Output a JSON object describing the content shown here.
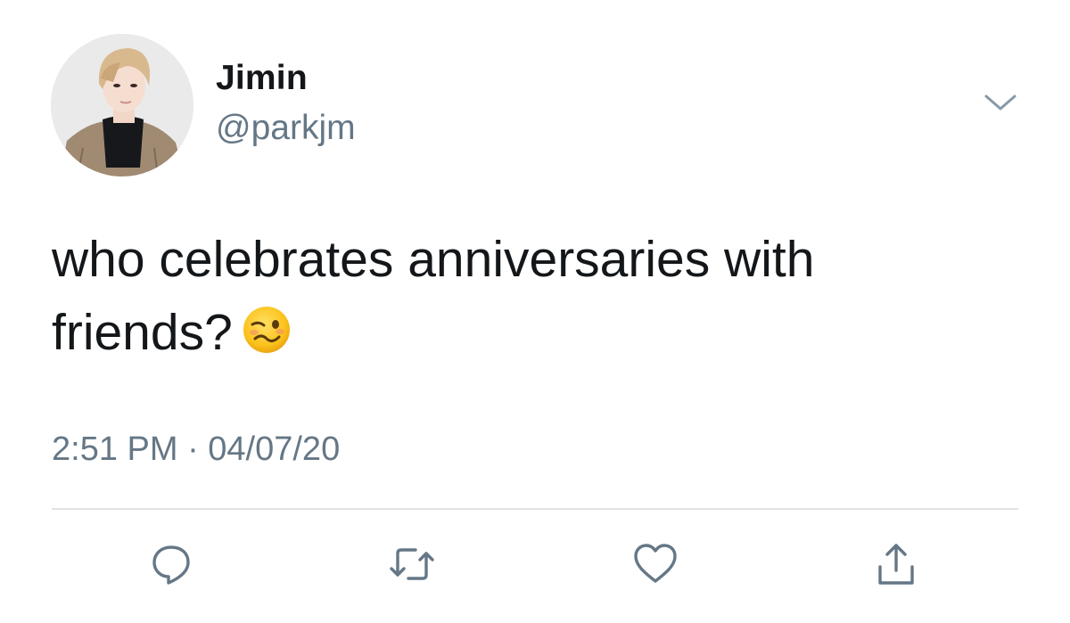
{
  "author": {
    "display_name": "Jimin",
    "handle": "@parkjm",
    "avatar_icon": "profile-photo"
  },
  "tweet": {
    "text_line1": "who celebrates anniversaries with",
    "text_line2": "friends?",
    "emoji": "woozy-face",
    "timestamp": "2:51 PM · 04/07/20"
  },
  "actions": {
    "reply_icon": "speech-bubble-icon",
    "retweet_icon": "retweet-icon",
    "like_icon": "heart-icon",
    "share_icon": "share-upload-icon",
    "more_icon": "chevron-down-icon"
  },
  "colors": {
    "text_primary": "#14171a",
    "text_secondary": "#657786",
    "divider": "#dfe3e6"
  }
}
